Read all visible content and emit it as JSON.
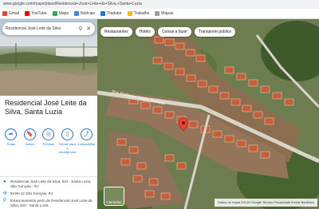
{
  "browser": {
    "url": "www.google.com/maps/place/Residencial+José+Leite+da+Silva,+Santa+Luzia",
    "bookmarks": [
      {
        "label": "Gmail",
        "color": "#ea4335"
      },
      {
        "label": "YouTube",
        "color": "#ff0000"
      },
      {
        "label": "Maps",
        "color": "#34a853"
      },
      {
        "label": "Notícias",
        "color": "#4285f4"
      },
      {
        "label": "Tradutor",
        "color": "#1a73e8"
      },
      {
        "label": "Trabalho",
        "color": "#fbbc04"
      },
      {
        "label": "Mapas",
        "color": "#9aa0a6"
      }
    ]
  },
  "panel": {
    "search_query": "Residencial José Leite da Silva",
    "title": "Residencial José Leite da Silva, Santa Luzia",
    "actions": [
      {
        "label": "Rotas",
        "icon": "directions-icon",
        "glyph": "➦"
      },
      {
        "label": "Salvar",
        "icon": "bookmark-icon",
        "glyph": "🔖"
      },
      {
        "label": "Próximo",
        "icon": "nearby-icon",
        "glyph": "◎"
      },
      {
        "label": "Enviar para o smartphone",
        "icon": "phone-icon",
        "glyph": "▯"
      },
      {
        "label": "Compartilhar",
        "icon": "share-icon",
        "glyph": "⤴"
      }
    ],
    "address": "Residencial José Leite da Silva, 810 - Santa Luzia, São Gonçalo - RJ",
    "plus_code": "5V26+J2 São Gonçalo, RJ",
    "nearby": "Estacionamento perto de Residencial José Leite da Silva, 810 - Santa Luzia"
  },
  "map": {
    "chips": [
      "Restaurantes",
      "Hotéis",
      "Coisas a fazer",
      "Transporte público"
    ],
    "road_label": "Rua Professor Castro Barbosa",
    "layers_label": "Camadas",
    "footer": "Dados do mapa ©2024 Google   Termos   Privacidade   Enviar feedback"
  }
}
